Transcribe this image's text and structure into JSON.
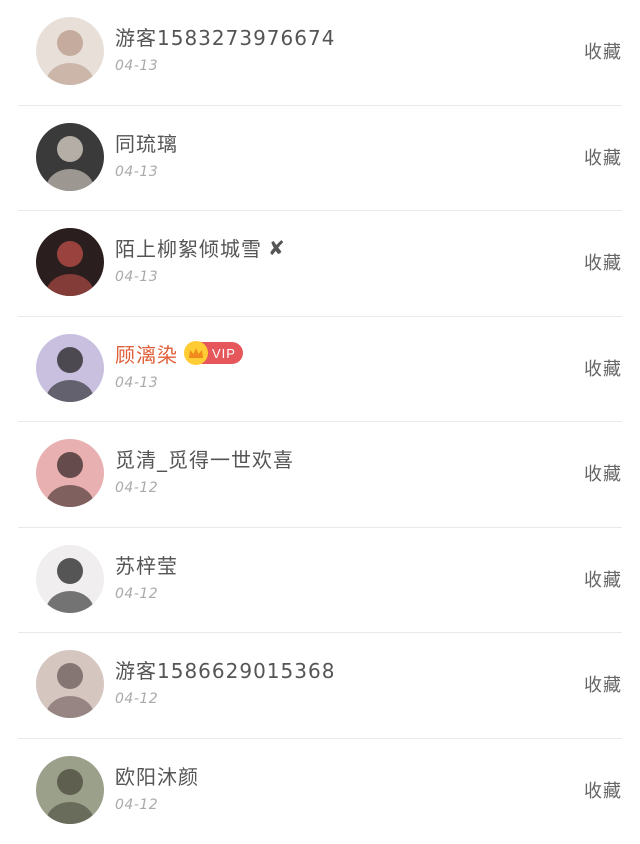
{
  "favorite_label": "收藏",
  "users": [
    {
      "name": "游客1583273976674",
      "date": "04-13",
      "avatar_color": "#e8e0d8",
      "avatar_accent": "#b89a8a"
    },
    {
      "name": "同琉璃",
      "date": "04-13",
      "avatar_color": "#3a3a3a",
      "avatar_accent": "#ddd5cc"
    },
    {
      "name": "陌上柳絮倾城雪",
      "date": "04-13",
      "avatar_color": "#2a1e1e",
      "avatar_accent": "#c0504a",
      "suffix": "✘"
    },
    {
      "name": "顾漓染",
      "date": "04-13",
      "avatar_color": "#c9c0e0",
      "avatar_accent": "#222222",
      "vip": true,
      "vip_label": "VIP"
    },
    {
      "name": "觅清_觅得一世欢喜",
      "date": "04-12",
      "avatar_color": "#e8b0b0",
      "avatar_accent": "#3a2a2a"
    },
    {
      "name": "苏梓莹",
      "date": "04-12",
      "avatar_color": "#f0eeee",
      "avatar_accent": "#222222"
    },
    {
      "name": "游客1586629015368",
      "date": "04-12",
      "avatar_color": "#d6c6c0",
      "avatar_accent": "#6a5a5a"
    },
    {
      "name": "欧阳沐颜",
      "date": "04-12",
      "avatar_color": "#9aa08a",
      "avatar_accent": "#4a4a3a"
    }
  ]
}
